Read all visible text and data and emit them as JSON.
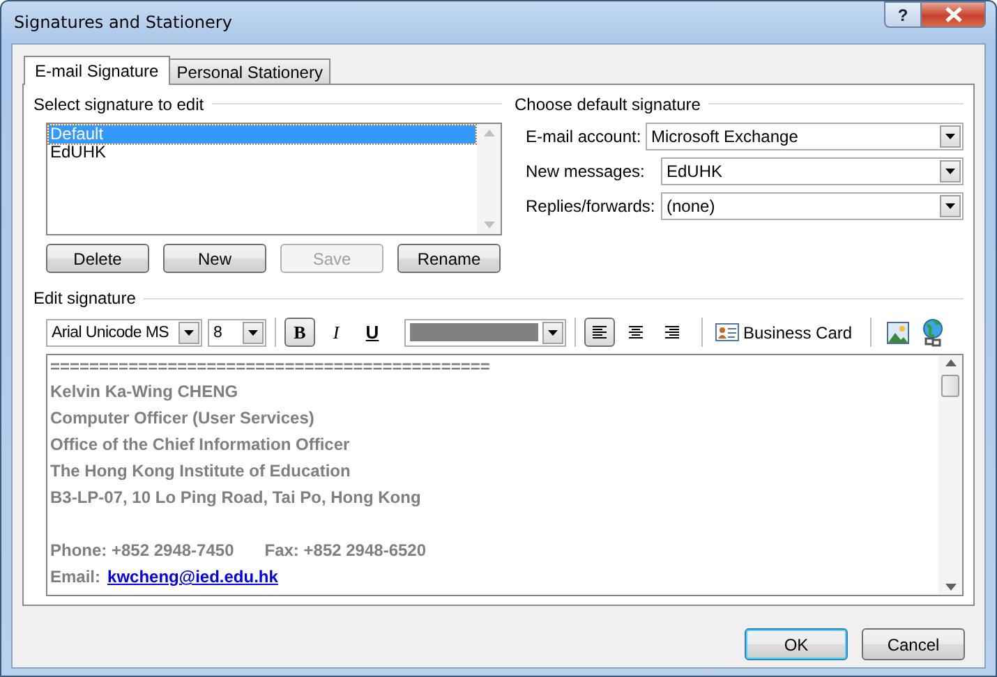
{
  "window": {
    "title": "Signatures and Stationery",
    "help": "?"
  },
  "tabs": [
    {
      "label": "E-mail Signature",
      "selected": true
    },
    {
      "label": "Personal Stationery",
      "selected": false
    }
  ],
  "select_signature": {
    "heading": "Select signature to edit",
    "items": [
      {
        "label": "Default",
        "selected": true
      },
      {
        "label": "EdUHK",
        "selected": false
      }
    ],
    "buttons": [
      {
        "label": "Delete",
        "disabled": false
      },
      {
        "label": "New",
        "disabled": false
      },
      {
        "label": "Save",
        "disabled": true
      },
      {
        "label": "Rename",
        "disabled": false
      }
    ]
  },
  "default_signature": {
    "heading": "Choose default signature",
    "fields": [
      {
        "label": "E-mail account:",
        "value": "Microsoft Exchange"
      },
      {
        "label": "New messages:",
        "value": "EdUHK"
      },
      {
        "label": "Replies/forwards:",
        "value": "(none)"
      }
    ]
  },
  "edit_signature": {
    "heading": "Edit signature",
    "font": "Arial Unicode MS",
    "size": "8",
    "format_buttons": [
      {
        "kind": "bold",
        "label": "B",
        "pressed": true
      },
      {
        "kind": "italic",
        "label": "I",
        "pressed": false
      },
      {
        "kind": "underline",
        "label": "U",
        "pressed": false
      }
    ],
    "align_buttons": [
      {
        "kind": "left",
        "pressed": true
      },
      {
        "kind": "center",
        "pressed": false
      },
      {
        "kind": "right",
        "pressed": false
      }
    ],
    "business_card": "Business Card",
    "lines": [
      {
        "kind": "text",
        "text": "============================================="
      },
      {
        "kind": "text",
        "text": "Kelvin Ka-Wing CHENG"
      },
      {
        "kind": "text",
        "text": "Computer Officer (User Services)"
      },
      {
        "kind": "text",
        "text": "Office of the Chief Information Officer"
      },
      {
        "kind": "text",
        "text": "The Hong Kong Institute of Education"
      },
      {
        "kind": "text",
        "text": "B3-LP-07, 10 Lo Ping Road, Tai Po, Hong Kong"
      },
      {
        "kind": "blank"
      },
      {
        "kind": "pair",
        "parts": [
          "Phone: +852 2948-7450",
          "Fax: +852 2948-6520"
        ]
      },
      {
        "kind": "link",
        "text": "Email:",
        "link": "kwcheng@ied.edu.hk"
      }
    ]
  },
  "footer_buttons": [
    {
      "label": "OK",
      "default": true
    },
    {
      "label": "Cancel",
      "default": false
    }
  ]
}
